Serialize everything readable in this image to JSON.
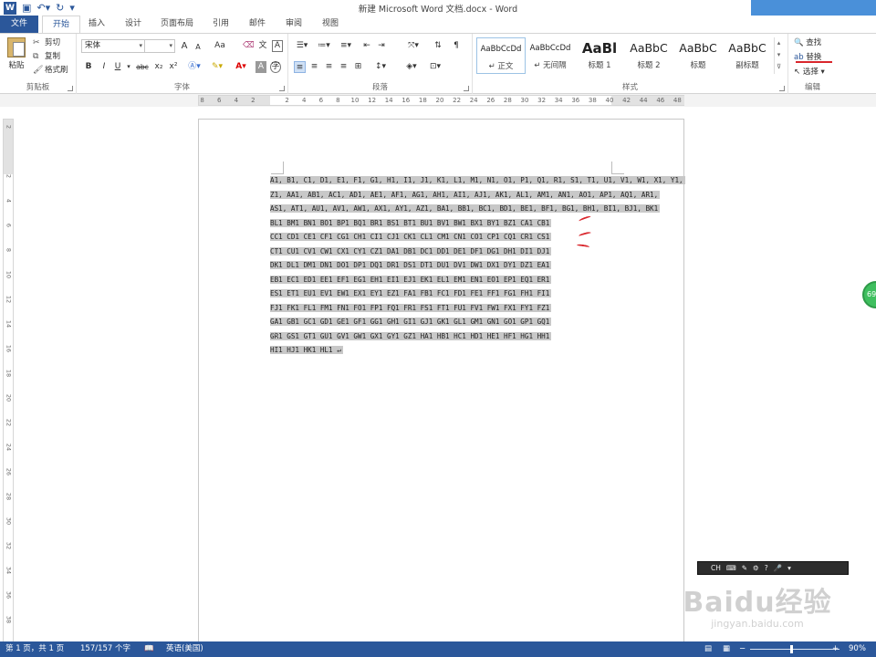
{
  "window": {
    "title": "新建 Microsoft Word 文档.docx - Word",
    "app_icon": "W"
  },
  "tabs": [
    {
      "label": "文件"
    },
    {
      "label": "开始"
    },
    {
      "label": "插入"
    },
    {
      "label": "设计"
    },
    {
      "label": "页面布局"
    },
    {
      "label": "引用"
    },
    {
      "label": "邮件"
    },
    {
      "label": "审阅"
    },
    {
      "label": "视图"
    }
  ],
  "ribbon": {
    "clipboard": {
      "paste": "粘贴",
      "cut": "剪切",
      "copy": "复制",
      "format_painter": "格式刷",
      "group_label": "剪贴板"
    },
    "font": {
      "font_name": "宋体",
      "font_size": "",
      "grow": "A",
      "shrink": "A",
      "change_case": "Aa",
      "bold": "B",
      "italic": "I",
      "underline": "U",
      "strike": "abc",
      "subscript": "x₂",
      "superscript": "x²",
      "group_label": "字体"
    },
    "paragraph": {
      "group_label": "段落"
    },
    "styles": {
      "items": [
        {
          "sample": "AaBbCcDd",
          "name": "↵ 正文"
        },
        {
          "sample": "AaBbCcDd",
          "name": "↵ 无间隔"
        },
        {
          "sample": "AaBl",
          "name": "标题 1"
        },
        {
          "sample": "AaBbC",
          "name": "标题 2"
        },
        {
          "sample": "AaBbC",
          "name": "标题"
        },
        {
          "sample": "AaBbC",
          "name": "副标题"
        }
      ],
      "group_label": "样式"
    },
    "editing": {
      "find": "查找",
      "replace": "替换",
      "select": "选择",
      "group_label": "编辑"
    }
  },
  "ruler": {
    "h_labels": [
      "8",
      "6",
      "4",
      "2",
      "",
      "2",
      "4",
      "6",
      "8",
      "10",
      "12",
      "14",
      "16",
      "18",
      "20",
      "22",
      "24",
      "26",
      "28",
      "30",
      "32",
      "34",
      "36",
      "38",
      "40",
      "42",
      "44",
      "46",
      "48"
    ],
    "v_labels": [
      "2",
      "",
      "2",
      "4",
      "6",
      "8",
      "10",
      "12",
      "14",
      "16",
      "18",
      "20",
      "22",
      "24",
      "26",
      "28",
      "30",
      "32",
      "34",
      "36",
      "38"
    ]
  },
  "document": {
    "lines": [
      "A1, B1, C1, D1, E1, F1, G1, H1, I1, J1, K1, L1, M1, N1, O1, P1, Q1, R1, S1, T1, U1, V1, W1, X1, Y1,",
      "Z1, AA1, AB1, AC1, AD1, AE1, AF1, AG1, AH1, AI1, AJ1, AK1, AL1, AM1, AN1, AO1, AP1, AQ1, AR1,",
      "AS1, AT1, AU1, AV1, AW1, AX1, AY1, AZ1, BA1, BB1, BC1, BD1, BE1, BF1, BG1, BH1, BI1, BJ1, BK1",
      "BL1  BM1  BN1  BO1  BP1  BQ1  BR1  BS1  BT1  BU1  BV1  BW1  BX1  BY1  BZ1  CA1  CB1",
      "CC1  CD1  CE1  CF1  CG1  CH1  CI1  CJ1  CK1  CL1  CM1  CN1  CO1  CP1  CQ1  CR1  CS1",
      "CT1  CU1  CV1  CW1  CX1  CY1  CZ1  DA1  DB1  DC1  DD1  DE1  DF1  DG1  DH1  DI1  DJ1",
      "DK1  DL1  DM1  DN1  DO1  DP1  DQ1  DR1  DS1  DT1  DU1  DV1  DW1  DX1  DY1  DZ1  EA1",
      "EB1  EC1  ED1  EE1  EF1  EG1  EH1  EI1  EJ1  EK1  EL1  EM1  EN1  EO1  EP1  EQ1  ER1",
      "ES1  ET1  EU1  EV1  EW1  EX1  EY1  EZ1  FA1  FB1  FC1  FD1  FE1  FF1  FG1  FH1  FI1",
      "FJ1  FK1  FL1  FM1  FN1  FO1  FP1  FQ1  FR1  FS1  FT1  FU1  FV1  FW1  FX1  FY1  FZ1",
      "GA1  GB1  GC1  GD1  GE1  GF1  GG1  GH1  GI1  GJ1  GK1  GL1  GM1  GN1  GO1  GP1  GQ1",
      "GR1  GS1  GT1  GU1  GV1  GW1  GX1  GY1  GZ1  HA1  HB1  HC1  HD1  HE1  HF1  HG1  HH1",
      "HI1  HJ1  HK1  HL1  ↵"
    ],
    "paragraph_mark": "↵"
  },
  "floating": {
    "green_badge": "69",
    "ime_label": "CH",
    "watermark_main": "Baidu经验",
    "watermark_sub": "jingyan.baidu.com"
  },
  "status": {
    "page": "第 1 页，共 1 页",
    "words": "157/157 个字",
    "language": "英语(美国)",
    "zoom_minus": "−",
    "zoom_plus": "+",
    "zoom": "90%"
  },
  "colors": {
    "brand": "#2b579a",
    "selection": "#c8c8c8",
    "annotation": "#d9262c"
  }
}
